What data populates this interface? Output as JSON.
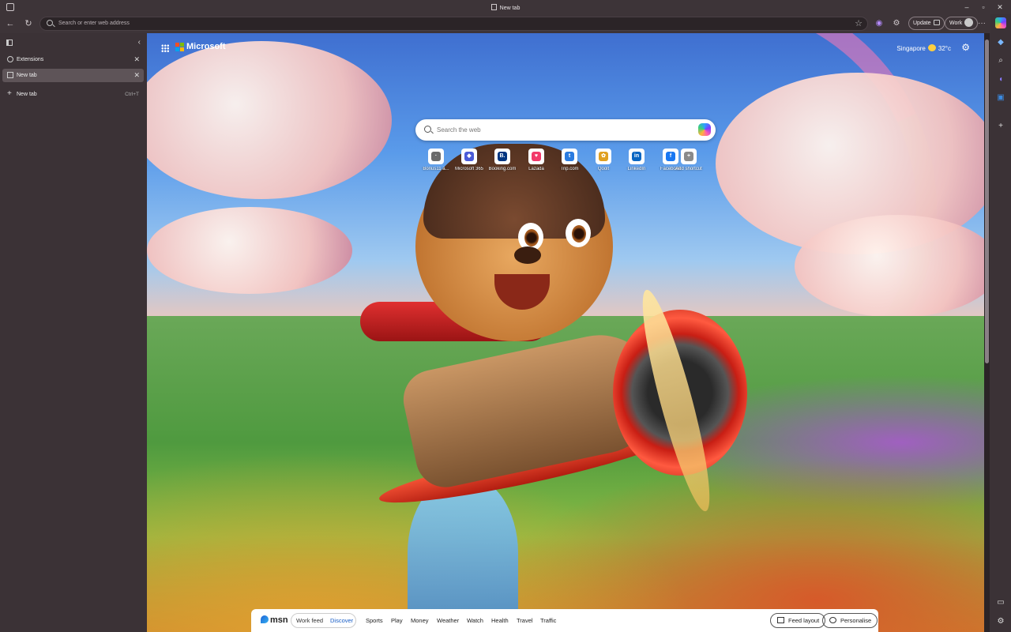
{
  "window": {
    "title": "New tab",
    "controls": [
      "–",
      "▫",
      "✕"
    ]
  },
  "toolbar": {
    "back_icon": "back-arrow-icon",
    "refresh_icon": "refresh-icon",
    "address_placeholder": "Search or enter web address",
    "update_label": "Update",
    "profile_label": "Work",
    "more_label": "···"
  },
  "tabs_pane": {
    "tabs": [
      {
        "label": "Extensions",
        "active": false
      },
      {
        "label": "New tab",
        "active": true
      }
    ],
    "new_tab_label": "New tab",
    "new_tab_shortcut": "Ctrl+T"
  },
  "ntp": {
    "brand": "Microsoft",
    "weather": {
      "city": "Singapore",
      "temp": "32°c"
    },
    "search_placeholder": "Search the web",
    "quick_links": [
      {
        "label": "Bonus11 a...",
        "color": "#6b6b6b",
        "glyph": "·"
      },
      {
        "label": "Microsoft 365",
        "color": "#4a5bd8",
        "glyph": "◆"
      },
      {
        "label": "Booking.com",
        "color": "#003580",
        "glyph": "B."
      },
      {
        "label": "Lazada",
        "color": "#f2396a",
        "glyph": "♥"
      },
      {
        "label": "Trip.com",
        "color": "#2a7be0",
        "glyph": "t"
      },
      {
        "label": "Qoolt",
        "color": "#e0a020",
        "glyph": "✿"
      },
      {
        "label": "LinkedIn",
        "color": "#0a66c2",
        "glyph": "in"
      },
      {
        "label": "Facebook",
        "color": "#1877f2",
        "glyph": "f"
      },
      {
        "label": "Add shortcut",
        "color": "#8a8a8a",
        "glyph": "+"
      }
    ]
  },
  "msn": {
    "logo": "msn",
    "feed_toggle": {
      "work": "Work feed",
      "discover": "Discover"
    },
    "nav": [
      "Sports",
      "Play",
      "Money",
      "Weather",
      "Watch",
      "Health",
      "Travel",
      "Traffic"
    ],
    "feed_layout": "Feed layout",
    "personalise": "Personalise"
  },
  "colors": {
    "accent": "#1a5fc7",
    "chrome": "#3d3438",
    "active_tab": "#5e5458"
  }
}
